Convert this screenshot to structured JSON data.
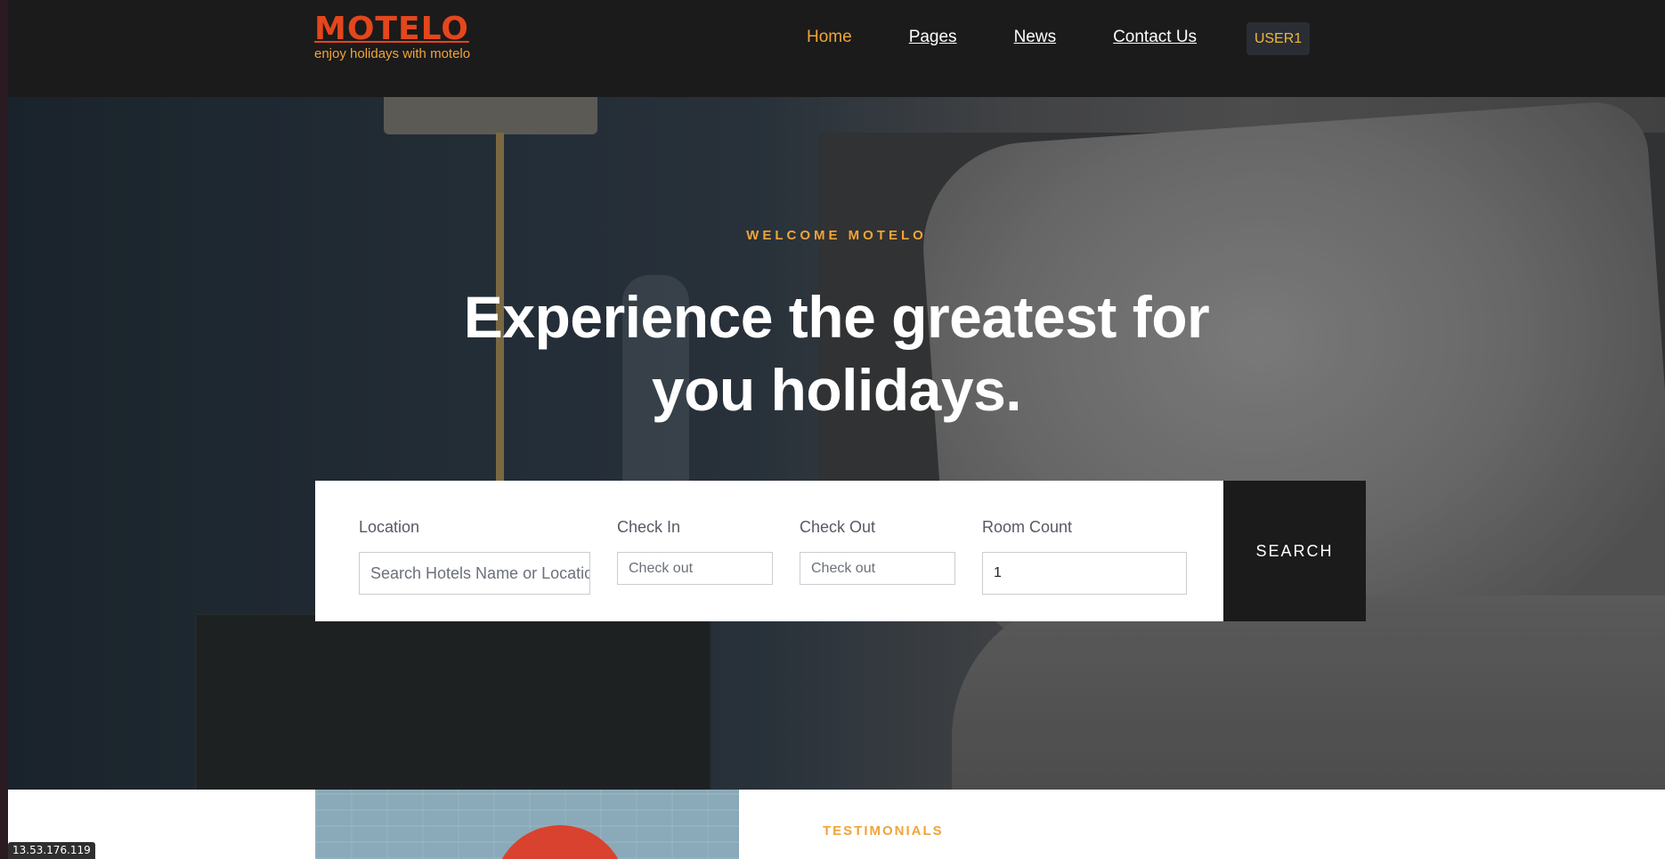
{
  "header": {
    "logo_title": "MOTELO",
    "logo_tagline": "enjoy holidays with motelo",
    "nav": [
      {
        "label": "Home",
        "active": true
      },
      {
        "label": "Pages",
        "active": false
      },
      {
        "label": "News",
        "active": false
      },
      {
        "label": "Contact Us",
        "active": false
      }
    ],
    "user_label": "USER1"
  },
  "hero": {
    "eyebrow": "WELCOME MOTELO",
    "headline_line1": "Experience the greatest for",
    "headline_line2": "you holidays."
  },
  "search": {
    "location_label": "Location",
    "location_placeholder": "Search Hotels Name or Location",
    "checkin_label": "Check In",
    "checkin_placeholder": "Check out",
    "checkout_label": "Check Out",
    "checkout_placeholder": "Check out",
    "room_label": "Room Count",
    "room_value": "1",
    "button_label": "SEARCH"
  },
  "section": {
    "testimonials_label": "TESTIMONIALS"
  },
  "status": {
    "ip": "13.53.176.119"
  },
  "colors": {
    "brand": "#e5461c",
    "accent": "#f0a43a",
    "dark": "#1b1b1b"
  }
}
